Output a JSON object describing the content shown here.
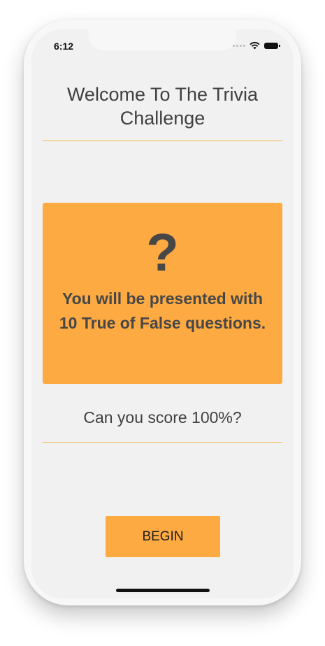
{
  "status_bar": {
    "time": "6:12"
  },
  "title": "Welcome To The Trivia Challenge",
  "card": {
    "icon": "question-mark-icon",
    "icon_glyph": "?",
    "text": "You will be presented with 10 True of False questions."
  },
  "subtitle": "Can you score 100%?",
  "begin_label": "BEGIN",
  "colors": {
    "accent": "#fdaa42",
    "text": "#404040",
    "background": "#f1f1f1"
  }
}
